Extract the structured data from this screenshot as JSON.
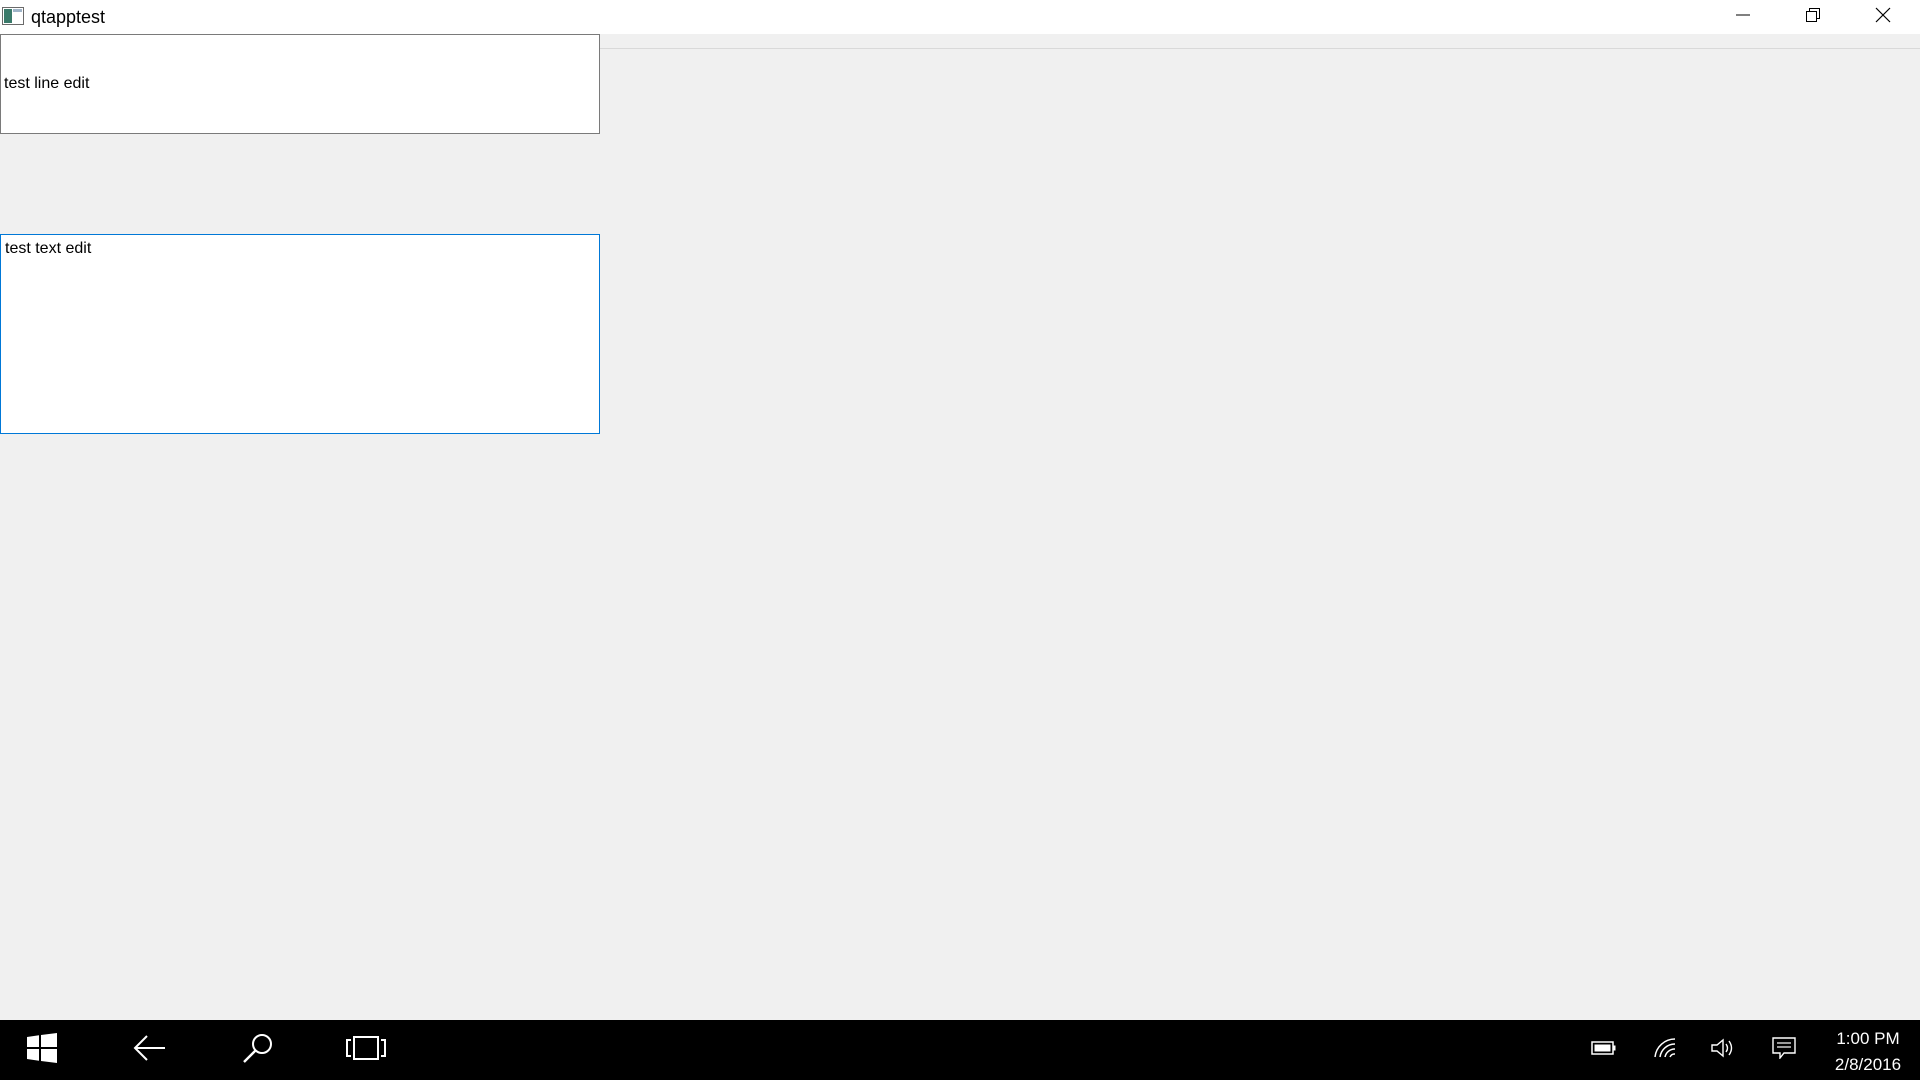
{
  "window": {
    "title": "qtapptest",
    "icons": [
      "app-icon",
      "minimize-icon",
      "maximize-icon",
      "close-icon"
    ]
  },
  "line_edit": {
    "value": "test line edit"
  },
  "text_edit": {
    "value": "test text edit"
  },
  "taskbar": {
    "icons": [
      "windows-start-icon",
      "back-arrow-icon",
      "search-icon",
      "task-view-icon",
      "battery-icon",
      "wifi-icon",
      "volume-icon",
      "action-center-icon"
    ],
    "time": "1:00 PM",
    "date": "2/8/2016"
  },
  "colors": {
    "titlebar": "#ffffff",
    "client_background": "#f0f0f0",
    "focus_border": "#0078d7",
    "taskbar": "#000000"
  }
}
